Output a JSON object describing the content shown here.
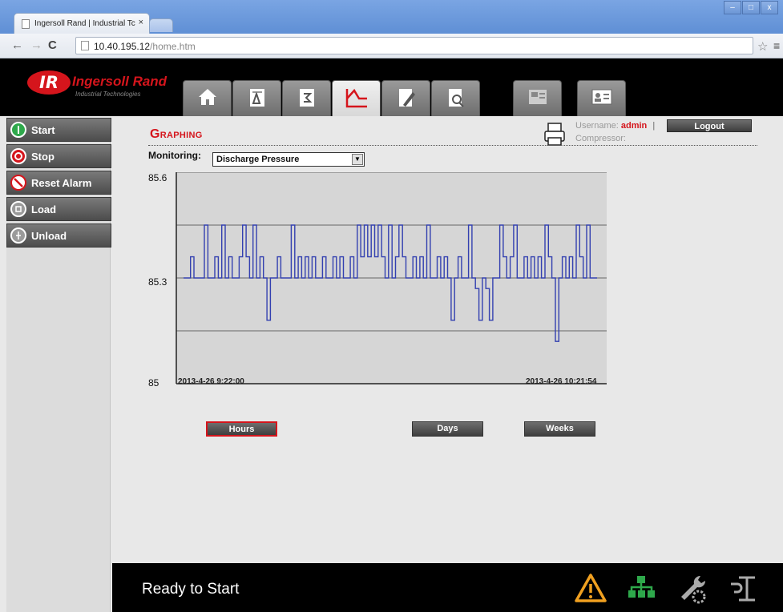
{
  "browser": {
    "tab_title": "Ingersoll Rand | Industrial Tc",
    "tab_close": "×",
    "url_host": "10.40.195.12",
    "url_path": "/home.htm",
    "back": "←",
    "forward": "→",
    "reload": "C",
    "star": "☆",
    "menu": "≡",
    "win_minimize": "–",
    "win_maximize": "□",
    "win_close": "x"
  },
  "header": {
    "logo_mark": "IR",
    "brand": "Ingersoll Rand",
    "subtitle": "Industrial Technologies",
    "tabs": [
      {
        "icon": "home-icon",
        "active": false
      },
      {
        "icon": "alarm-log-icon",
        "active": false
      },
      {
        "icon": "event-log-icon",
        "active": false
      },
      {
        "icon": "graph-icon",
        "active": true
      },
      {
        "icon": "settings-edit-icon",
        "active": false
      },
      {
        "icon": "search-document-icon",
        "active": false
      },
      {
        "icon": "maintenance-icon",
        "active": false
      },
      {
        "icon": "user-card-icon",
        "active": false
      }
    ]
  },
  "sidebar": {
    "items": [
      {
        "label": "Start",
        "icon": "start-icon",
        "color": "#2ea84b"
      },
      {
        "label": "Stop",
        "icon": "stop-icon",
        "color": "#d5151c"
      },
      {
        "label": "Reset Alarm",
        "icon": "reset-alarm-icon",
        "color": "#d5151c"
      },
      {
        "label": "Load",
        "icon": "load-icon",
        "color": "#c9c9c9"
      },
      {
        "label": "Unload",
        "icon": "unload-icon",
        "color": "#c9c9c9"
      }
    ]
  },
  "main": {
    "section_title": "Graphing",
    "username_label": "Username:",
    "username": "admin",
    "separator": "|",
    "compressor_label": "Compressor:",
    "logout_label": "Logout",
    "monitoring_label": "Monitoring:",
    "monitoring_value": "Discharge Pressure",
    "range_buttons": [
      {
        "label": "Hours",
        "active": true
      },
      {
        "label": "Days",
        "active": false
      },
      {
        "label": "Weeks",
        "active": false
      }
    ]
  },
  "chart_data": {
    "type": "line",
    "title": "",
    "xlabel": "",
    "ylabel": "",
    "x_start_label": "2013-4-26 9:22:00",
    "x_end_label": "2013-4-26 10:21:54",
    "y_ticks": [
      "85.6",
      "85.3",
      "85"
    ],
    "ylim": [
      85.0,
      85.6
    ],
    "grid": true,
    "series": [
      {
        "color": "#3340b0",
        "values": [
          85.3,
          85.3,
          85.36,
          85.3,
          85.3,
          85.3,
          85.45,
          85.3,
          85.3,
          85.36,
          85.3,
          85.45,
          85.3,
          85.36,
          85.3,
          85.3,
          85.36,
          85.45,
          85.36,
          85.3,
          85.45,
          85.3,
          85.36,
          85.3,
          85.18,
          85.3,
          85.3,
          85.36,
          85.3,
          85.3,
          85.3,
          85.45,
          85.3,
          85.36,
          85.3,
          85.36,
          85.3,
          85.36,
          85.3,
          85.3,
          85.36,
          85.3,
          85.3,
          85.36,
          85.3,
          85.36,
          85.3,
          85.3,
          85.36,
          85.3,
          85.45,
          85.36,
          85.45,
          85.36,
          85.45,
          85.36,
          85.45,
          85.36,
          85.3,
          85.45,
          85.3,
          85.36,
          85.45,
          85.36,
          85.3,
          85.3,
          85.36,
          85.3,
          85.36,
          85.3,
          85.45,
          85.3,
          85.3,
          85.36,
          85.3,
          85.36,
          85.3,
          85.18,
          85.3,
          85.36,
          85.3,
          85.3,
          85.45,
          85.3,
          85.27,
          85.18,
          85.3,
          85.27,
          85.18,
          85.3,
          85.3,
          85.45,
          85.36,
          85.3,
          85.36,
          85.45,
          85.3,
          85.3,
          85.36,
          85.3,
          85.36,
          85.3,
          85.36,
          85.3,
          85.45,
          85.36,
          85.3,
          85.12,
          85.3,
          85.36,
          85.3,
          85.36,
          85.3,
          85.45,
          85.36,
          85.3,
          85.45,
          85.3,
          85.3
        ]
      }
    ]
  },
  "footer": {
    "status": "Ready to Start",
    "icons": [
      "warning-icon",
      "network-icon",
      "wrench-gear-icon",
      "service-icon"
    ]
  },
  "colors": {
    "brand_red": "#d5151c",
    "chart_line": "#3340b0",
    "warning": "#f0a020",
    "network": "#2ea84b"
  }
}
